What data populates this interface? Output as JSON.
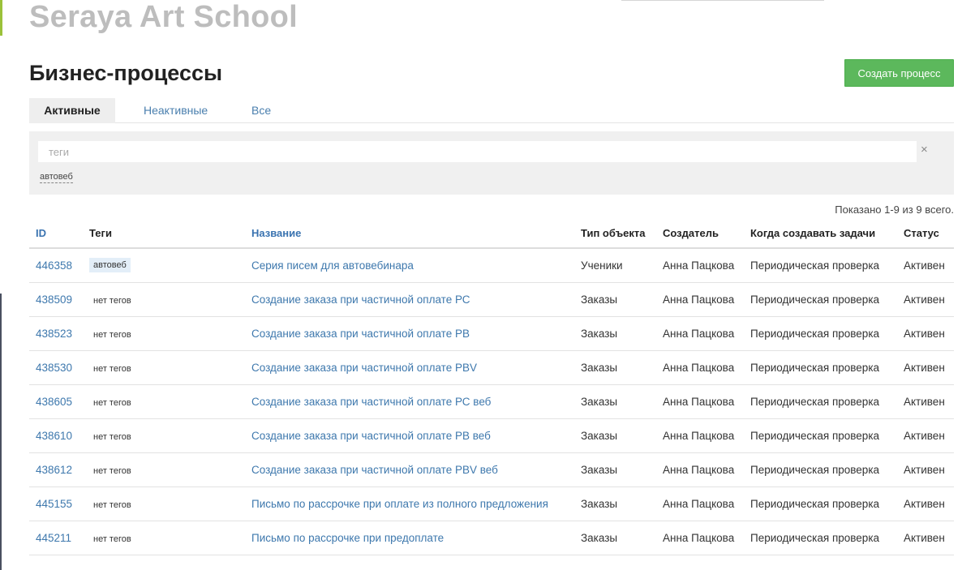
{
  "header": {
    "school_name": "Seraya Art School",
    "page_title": "Бизнес-процессы",
    "create_button": "Создать процесс"
  },
  "tabs": [
    {
      "label": "Активные",
      "active": true
    },
    {
      "label": "Неактивные",
      "active": false
    },
    {
      "label": "Все",
      "active": false
    }
  ],
  "filter": {
    "placeholder": "теги",
    "clear": "×",
    "suggested_tag": "автовеб"
  },
  "summary": "Показано 1-9 из 9 всего.",
  "table": {
    "headers": {
      "id": "ID",
      "tags": "Теги",
      "name": "Название",
      "object_type": "Тип объекта",
      "creator": "Создатель",
      "when": "Когда создавать задачи",
      "status": "Статус"
    },
    "rows": [
      {
        "id": "446358",
        "tag": "автовеб",
        "has_tag": true,
        "name": "Серия писем для автовебинара",
        "object_type": "Ученики",
        "creator": "Анна Пацкова",
        "when": "Периодическая проверка",
        "status": "Активен"
      },
      {
        "id": "438509",
        "tag": "нет тегов",
        "has_tag": false,
        "name": "Создание заказа при частичной оплате РС",
        "object_type": "Заказы",
        "creator": "Анна Пацкова",
        "when": "Периодическая проверка",
        "status": "Активен"
      },
      {
        "id": "438523",
        "tag": "нет тегов",
        "has_tag": false,
        "name": "Создание заказа при частичной оплате РВ",
        "object_type": "Заказы",
        "creator": "Анна Пацкова",
        "when": "Периодическая проверка",
        "status": "Активен"
      },
      {
        "id": "438530",
        "tag": "нет тегов",
        "has_tag": false,
        "name": "Создание заказа при частичной оплате PBV",
        "object_type": "Заказы",
        "creator": "Анна Пацкова",
        "when": "Периодическая проверка",
        "status": "Активен"
      },
      {
        "id": "438605",
        "tag": "нет тегов",
        "has_tag": false,
        "name": "Создание заказа при частичной оплате РС веб",
        "object_type": "Заказы",
        "creator": "Анна Пацкова",
        "when": "Периодическая проверка",
        "status": "Активен"
      },
      {
        "id": "438610",
        "tag": "нет тегов",
        "has_tag": false,
        "name": "Создание заказа при частичной оплате РВ веб",
        "object_type": "Заказы",
        "creator": "Анна Пацкова",
        "when": "Периодическая проверка",
        "status": "Активен"
      },
      {
        "id": "438612",
        "tag": "нет тегов",
        "has_tag": false,
        "name": "Создание заказа при частичной оплате PBV веб",
        "object_type": "Заказы",
        "creator": "Анна Пацкова",
        "when": "Периодическая проверка",
        "status": "Активен"
      },
      {
        "id": "445155",
        "tag": "нет тегов",
        "has_tag": false,
        "name": "Письмо по рассрочке при оплате из полного предложения",
        "object_type": "Заказы",
        "creator": "Анна Пацкова",
        "when": "Периодическая проверка",
        "status": "Активен"
      },
      {
        "id": "445211",
        "tag": "нет тегов",
        "has_tag": false,
        "name": "Письмо по рассрочке при предоплате",
        "object_type": "Заказы",
        "creator": "Анна Пацкова",
        "when": "Периодическая проверка",
        "status": "Активен"
      }
    ]
  },
  "colors": {
    "accent_link": "#3e78ad",
    "button_green": "#5cb85c",
    "title_gray": "#bdbdbd"
  }
}
